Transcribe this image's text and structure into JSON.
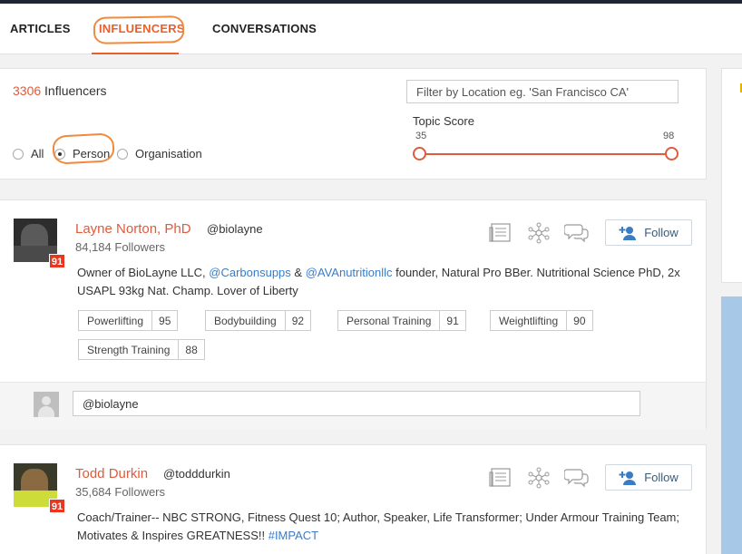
{
  "tabs": [
    {
      "label": "ARTICLES",
      "active": false
    },
    {
      "label": "INFLUENCERS",
      "active": true
    },
    {
      "label": "CONVERSATIONS",
      "active": false
    }
  ],
  "filters": {
    "count": "3306",
    "count_label": "Influencers",
    "location_placeholder": "Filter by Location eg. 'San Francisco CA'",
    "topic_score": {
      "label": "Topic Score",
      "min": "35",
      "max": "98"
    },
    "type_options": [
      {
        "label": "All",
        "selected": false
      },
      {
        "label": "Person",
        "selected": true
      },
      {
        "label": "Organisation",
        "selected": false
      }
    ]
  },
  "influencers": [
    {
      "name": "Layne Norton, PhD",
      "handle": "@biolayne",
      "followers": "84,184 Followers",
      "score": "91",
      "follow_label": "Follow",
      "bio": {
        "p1": "Owner of BioLayne LLC, ",
        "l1": "@Carbonsupps",
        "p2": " & ",
        "l2": "@AVAnutritionllc",
        "p3": " founder, Natural Pro BBer. Nutritional Science PhD, 2x USAPL 93kg Nat. Champ. Lover of Liberty"
      },
      "topics": [
        {
          "name": "Powerlifting",
          "score": "95"
        },
        {
          "name": "Bodybuilding",
          "score": "92"
        },
        {
          "name": "Personal Training",
          "score": "91"
        },
        {
          "name": "Weightlifting",
          "score": "90"
        },
        {
          "name": "Strength Training",
          "score": "88"
        }
      ],
      "reply_value": "@biolayne"
    },
    {
      "name": "Todd Durkin",
      "handle": "@todddurkin",
      "followers": "35,684 Followers",
      "score": "91",
      "follow_label": "Follow",
      "bio": {
        "p1": "Coach/Trainer-- NBC STRONG, Fitness Quest 10; Author, Speaker, Life Transformer; Under Armour Training Team; Motivates & Inspires GREATNESS!! ",
        "l1": "#IMPACT"
      }
    }
  ],
  "colors": {
    "accent": "#e05a3b",
    "annotation": "#f08a3c",
    "link": "#3b7cc4",
    "badge": "#e8361f"
  }
}
